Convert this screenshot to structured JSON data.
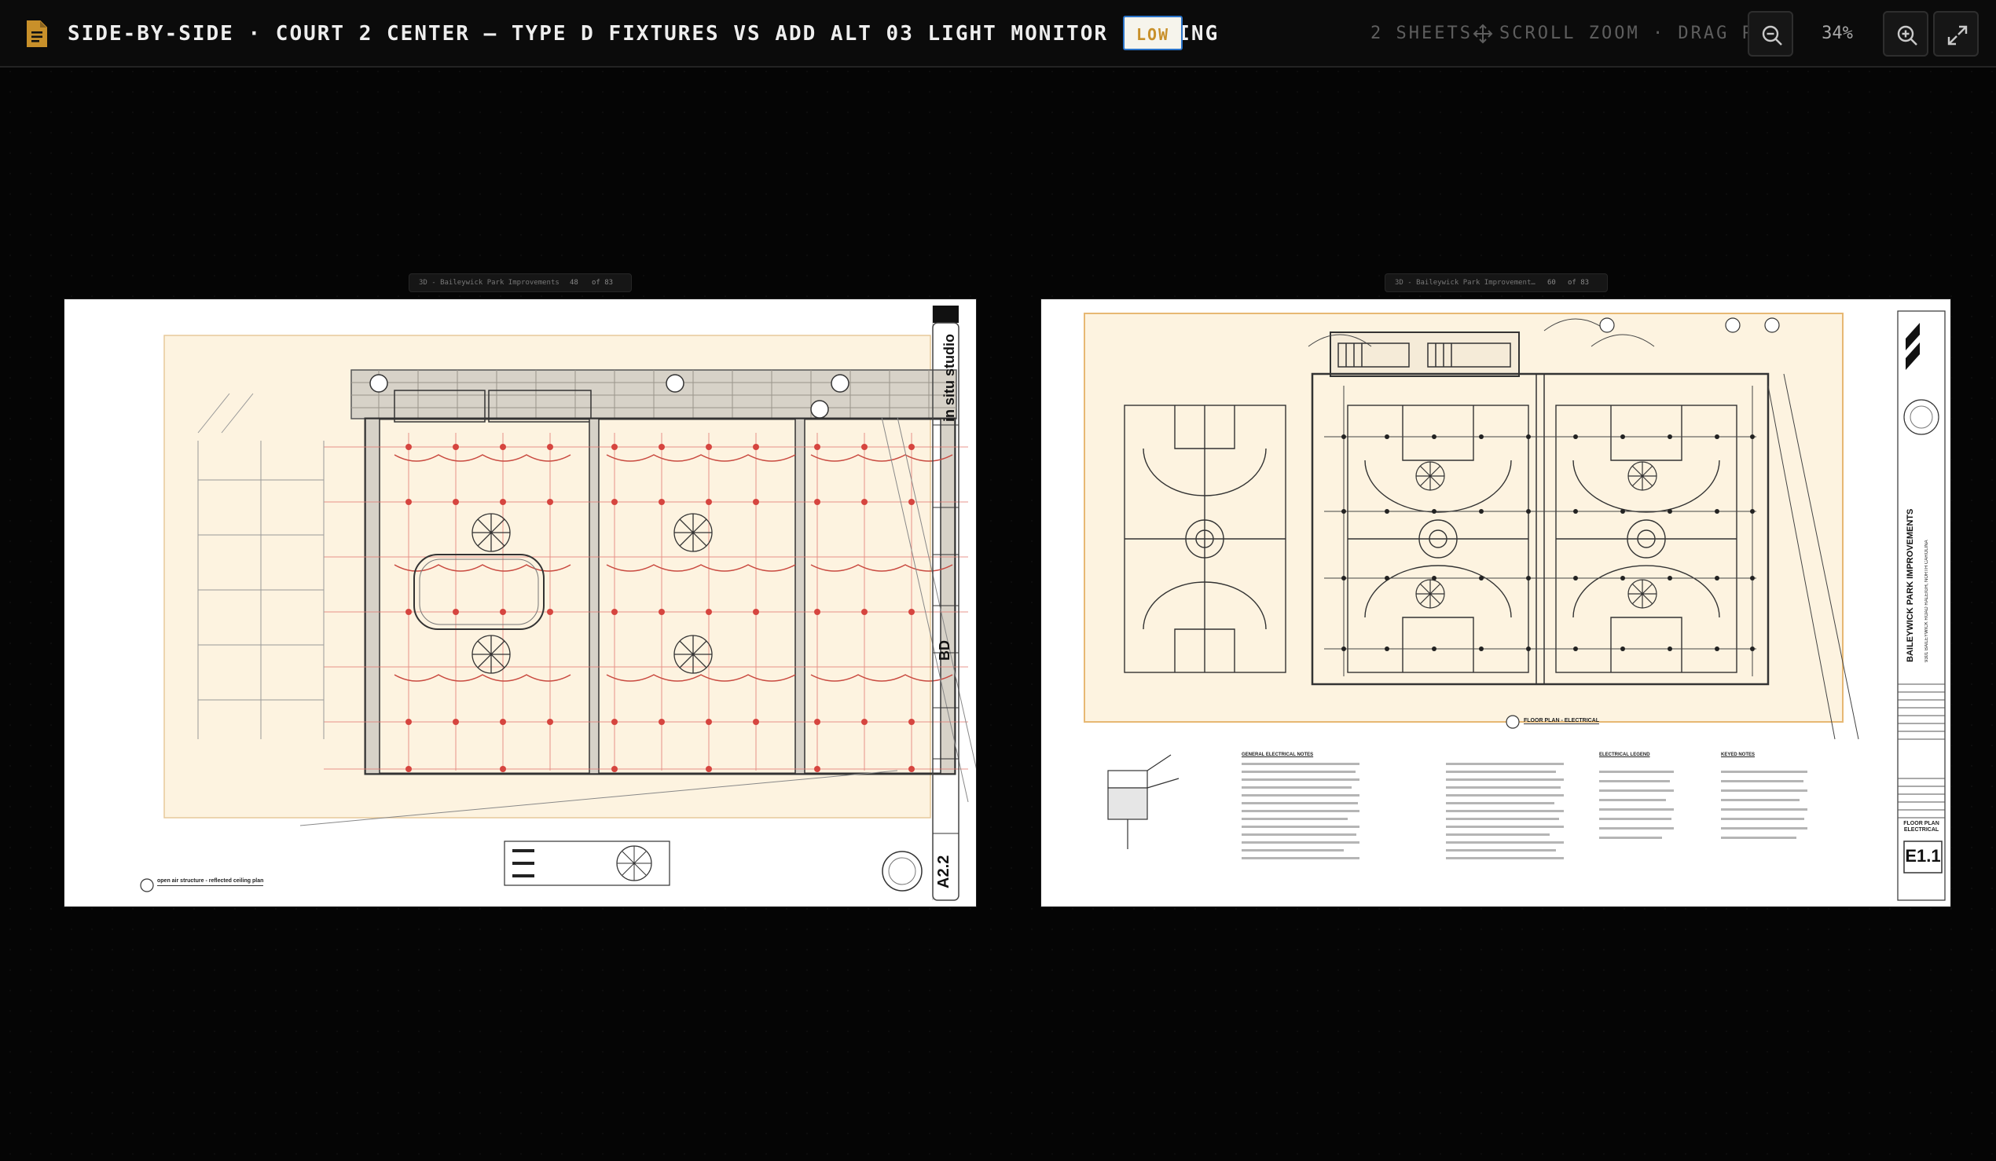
{
  "header": {
    "title": "SIDE-BY-SIDE · COURT 2 CENTER — TYPE D FIXTURES VS ADD ALT 03 LIGHT MONITOR FRAMING",
    "badge": "LOW",
    "sheet_count": "2 SHEETS",
    "hint": "SCROLL ZOOM · DRAG PAN",
    "zoom": "34%",
    "icons": [
      "document-icon",
      "move-icon",
      "zoom-out-icon",
      "zoom-in-icon",
      "expand-icon"
    ]
  },
  "sheets": [
    {
      "toolbar_label": "3D - Baileywick Park Improvements",
      "page": "48",
      "page_total": "of 83",
      "studio": "in situ studio",
      "mark": "BD",
      "sheet_number": "A2.2",
      "plan_title": "open air structure - reflected ceiling plan"
    },
    {
      "toolbar_label": "3D - Baileywick Park Improvement…",
      "page": "60",
      "page_total": "of 83",
      "project": "BAILEYWICK PARK IMPROVEMENTS",
      "address": "9301 BAILEYWICK ROAD RALEIGH, NORTH CAROLINA",
      "plan_caption": "FLOOR PLAN - ELECTRICAL",
      "sheet_title": "FLOOR PLAN ELECTRICAL",
      "sheet_number": "E1.1",
      "notes_heading": "GENERAL ELECTRICAL NOTES",
      "legend_heading": "ELECTRICAL LEGEND",
      "keyed_heading": "KEYED NOTES"
    }
  ],
  "colors": {
    "background": "#050505",
    "topbar": "#0b0b0b",
    "badge_text": "#c8902a",
    "badge_border": "#2a73c9",
    "plan_tint": "#fdf3e0",
    "fixture_red": "#d6453f"
  }
}
